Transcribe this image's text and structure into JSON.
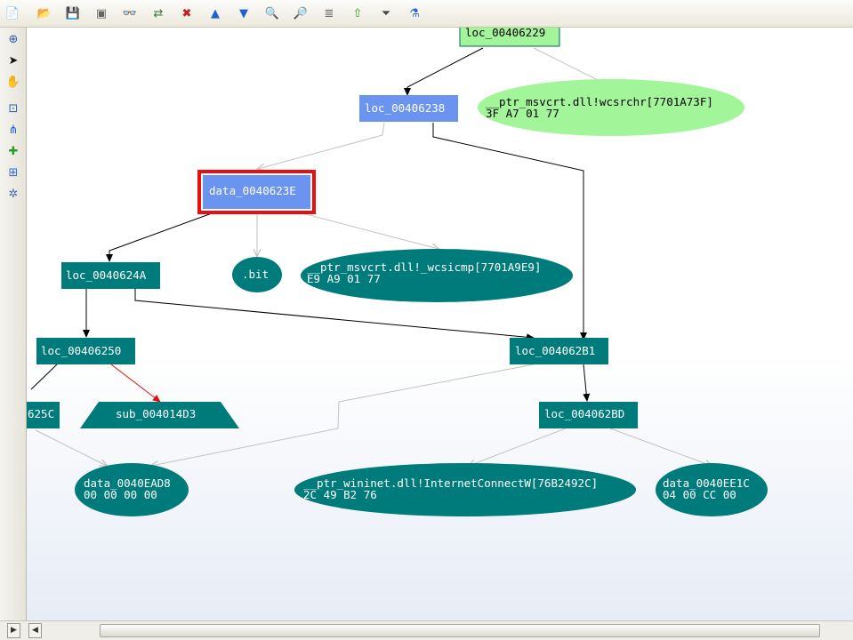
{
  "toolbar": {
    "buttons": [
      {
        "name": "new-file-icon",
        "glyph": "📄"
      },
      {
        "name": "open-folder-icon",
        "glyph": "📂"
      },
      {
        "name": "save-icon",
        "glyph": "💾"
      },
      {
        "name": "print-icon",
        "glyph": "▣"
      },
      {
        "name": "glasses-icon",
        "glyph": "👓"
      },
      {
        "name": "refresh-arrows-icon",
        "glyph": "⇄"
      },
      {
        "name": "stop-icon",
        "glyph": "✖"
      },
      {
        "name": "up-arrow-icon",
        "glyph": "▲"
      },
      {
        "name": "down-arrow-icon",
        "glyph": "▼"
      },
      {
        "name": "zoom-in-icon",
        "glyph": "🔍"
      },
      {
        "name": "zoom-out-icon",
        "glyph": "🔎"
      },
      {
        "name": "document-icon",
        "glyph": "≣"
      },
      {
        "name": "green-arrow-up-icon",
        "glyph": "⇧"
      },
      {
        "name": "filter-icon",
        "glyph": "⏷"
      },
      {
        "name": "filter-settings-icon",
        "glyph": "⚗"
      }
    ]
  },
  "sidebar": {
    "buttons": [
      {
        "name": "zoom-window-icon",
        "glyph": "⊕"
      },
      {
        "name": "select-pointer-icon",
        "glyph": "➤"
      },
      {
        "name": "hand-pan-icon",
        "glyph": "✋"
      },
      {
        "name": "fit-view-icon",
        "glyph": "⊡"
      },
      {
        "name": "layout-tree-icon",
        "glyph": "⋔"
      },
      {
        "name": "add-node-icon",
        "glyph": "✚"
      },
      {
        "name": "new-window-icon",
        "glyph": "⊞"
      },
      {
        "name": "settings-tools-icon",
        "glyph": "✲"
      }
    ]
  },
  "colors": {
    "teal": "#007b7b",
    "blue": "#6b94f0",
    "green": "#a3f59a",
    "selection": "#e61010",
    "red_edge": "#e01010",
    "gray_edge": "#c2c2c2",
    "black_edge": "#000000"
  },
  "graph": {
    "nodes": {
      "loc_00406229": "loc_00406229",
      "wcsrchr_name": "__ptr_msvcrt.dll!wcsrchr[7701A73F]",
      "wcsrchr_bytes": "3F A7 01 77",
      "loc_00406238": "loc_00406238",
      "data_0040623E": "data_0040623E",
      "bit": ".bit",
      "wcsicmp_name": "__ptr_msvcrt.dll!_wcsicmp[7701A9E9]",
      "wcsicmp_bytes": "E9 A9 01 77",
      "loc_0040624A": "loc_0040624A",
      "loc_00406250": "loc_00406250",
      "partial_625C": "625C",
      "sub_004014D3": "sub_004014D3",
      "loc_004062B1": "loc_004062B1",
      "loc_004062BD": "loc_004062BD",
      "data_0040EAD8_name": "data_0040EAD8",
      "data_0040EAD8_bytes": "00 00 00 00",
      "internetconnect_name": "__ptr_wininet.dll!InternetConnectW[76B2492C]",
      "internetconnect_bytes": "2C 49 B2 76",
      "data_0040EE1C_name": "data_0040EE1C",
      "data_0040EE1C_bytes": "04 00 CC 00"
    }
  },
  "scrollbar": {
    "left_arrow": "◀",
    "right_arrow": "▶"
  }
}
